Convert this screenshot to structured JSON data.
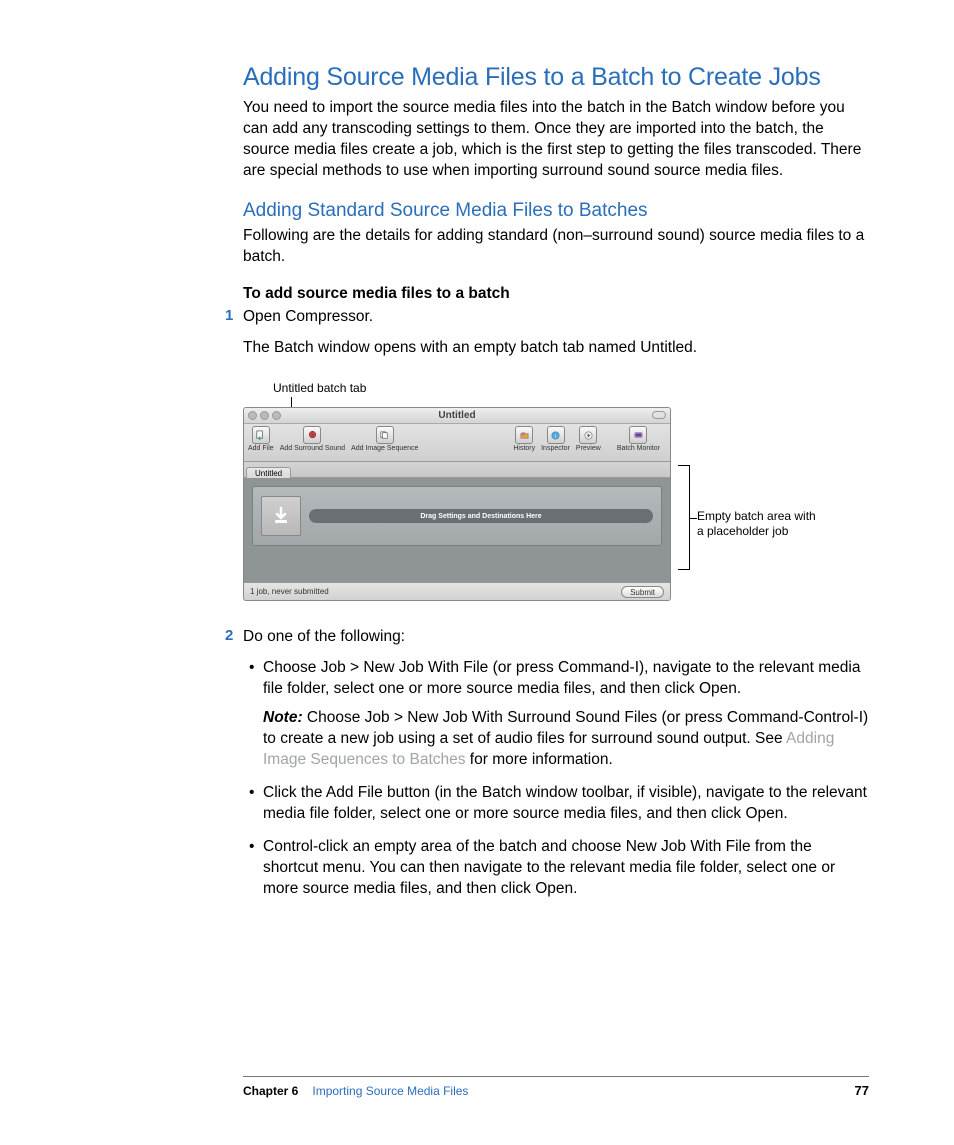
{
  "heading1": "Adding Source Media Files to a Batch to Create Jobs",
  "intro": "You need to import the source media files into the batch in the Batch window before you can add any transcoding settings to them. Once they are imported into the batch, the source media files create a job, which is the first step to getting the files transcoded. There are special methods to use when importing surround sound source media files.",
  "heading2": "Adding Standard Source Media Files to Batches",
  "subintro": "Following are the details for adding standard (non–surround sound) source media files to a batch.",
  "task_title": "To add source media files to a batch",
  "step1_num": "1",
  "step1_text": "Open Compressor.",
  "step1_result": "The Batch window opens with an empty batch tab named Untitled.",
  "callout_top": "Untitled batch tab",
  "callout_right_l1": "Empty batch area with",
  "callout_right_l2": "a placeholder job",
  "window": {
    "title": "Untitled",
    "toolbar": {
      "add_file": "Add File",
      "add_surround": "Add Surround Sound",
      "add_image_seq": "Add Image Sequence",
      "history": "History",
      "inspector": "Inspector",
      "preview": "Preview",
      "batch_monitor": "Batch Monitor"
    },
    "tab": "Untitled",
    "dropzone": "Drag Settings and Destinations Here",
    "status": "1 job, never submitted",
    "submit": "Submit"
  },
  "step2_num": "2",
  "step2_text": "Do one of the following:",
  "bullet1": "Choose Job > New Job With File (or press Command-I), navigate to the relevant media file folder, select one or more source media files, and then click Open.",
  "note_label": "Note:",
  "note_text_a": "  Choose Job > New Job With Surround Sound Files (or press Command-Control-I) to create a new job using a set of audio files for surround sound output. See ",
  "note_link": "Adding Image Sequences to Batches",
  "note_text_b": " for more information.",
  "bullet2": "Click the Add File button (in the Batch window toolbar, if visible), navigate to the relevant media file folder, select one or more source media files, and then click Open.",
  "bullet3": "Control-click an empty area of the batch and choose New Job With File from the shortcut menu. You can then navigate to the relevant media file folder, select one or more source media files, and then click Open.",
  "footer": {
    "chapter": "Chapter 6",
    "title": "Importing Source Media Files",
    "page": "77"
  }
}
